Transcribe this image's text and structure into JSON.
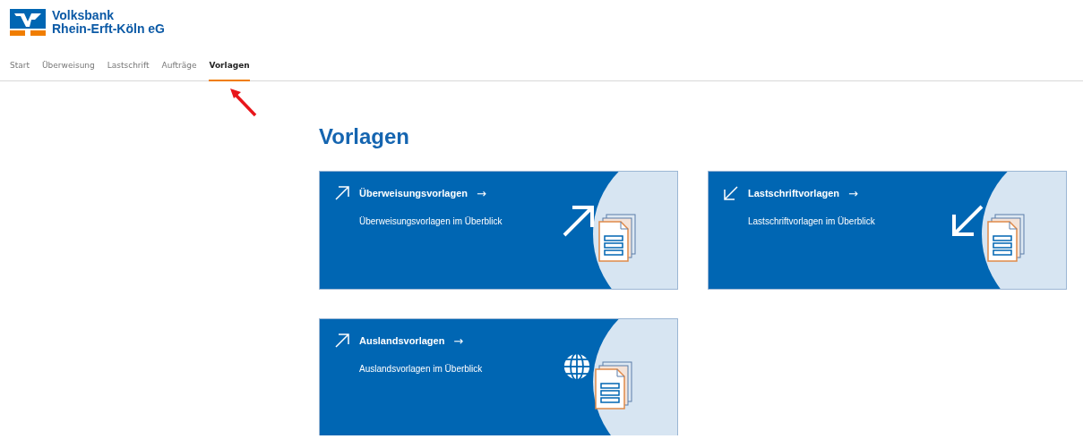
{
  "bank": {
    "name_line1": "Volksbank",
    "name_line2": "Rhein-Erft-Köln eG"
  },
  "nav": [
    {
      "label": "Start",
      "selected": false
    },
    {
      "label": "Überweisung",
      "selected": false
    },
    {
      "label": "Lastschrift",
      "selected": false
    },
    {
      "label": "Aufträge",
      "selected": false
    },
    {
      "label": "Vorlagen",
      "selected": true
    }
  ],
  "page_title": "Vorlagen",
  "cards": [
    {
      "kind": "outgoing",
      "title": "Überweisungsvorlagen",
      "arrow": "→",
      "subtitle": "Überweisungsvorlagen im Überblick"
    },
    {
      "kind": "incoming",
      "title": "Lastschriftvorlagen",
      "arrow": "→",
      "subtitle": "Lastschriftvorlagen im Überblick"
    },
    {
      "kind": "foreign",
      "title": "Auslandsvorlagen",
      "arrow": "→",
      "subtitle": "Auslandsvorlagen im Überblick"
    }
  ]
}
